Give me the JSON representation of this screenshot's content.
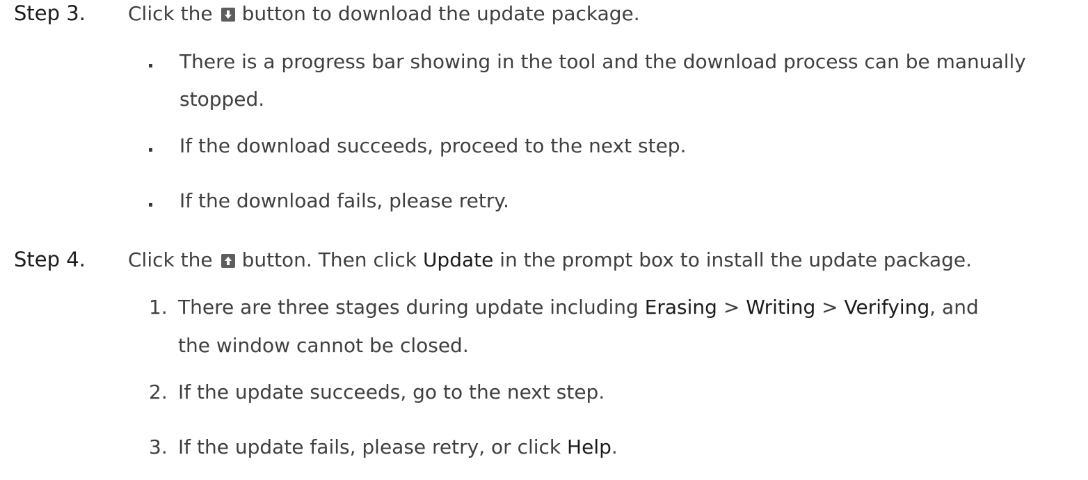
{
  "step3": {
    "label": "Step 3.",
    "pre": "Click the",
    "icon": "download-arrow-icon",
    "post": "button to download the update package.",
    "bullets": [
      "There is a progress bar showing in the tool and the download process can be manually",
      "stopped.",
      "If the download succeeds, proceed to the next step.",
      "If the download fails, please retry."
    ]
  },
  "step4": {
    "label": "Step 4.",
    "pre": "Click the",
    "icon": "upload-arrow-icon",
    "post_a": "button. Then click",
    "post_bold": "Update",
    "post_b": "in the prompt box to install the update package.",
    "items": [
      {
        "num": "1.",
        "a": "There are three stages during update including",
        "s1": "Erasing",
        "sep1": ">",
        "s2": "Writing",
        "sep2": ">",
        "s3": "Verifying",
        "b": ", and",
        "cont": "the window cannot be closed."
      },
      {
        "num": "2.",
        "text": "If the update succeeds, go to the next step."
      },
      {
        "num": "3.",
        "a": "If the update fails, please retry, or click",
        "bold": "Help",
        "b": "."
      }
    ]
  }
}
